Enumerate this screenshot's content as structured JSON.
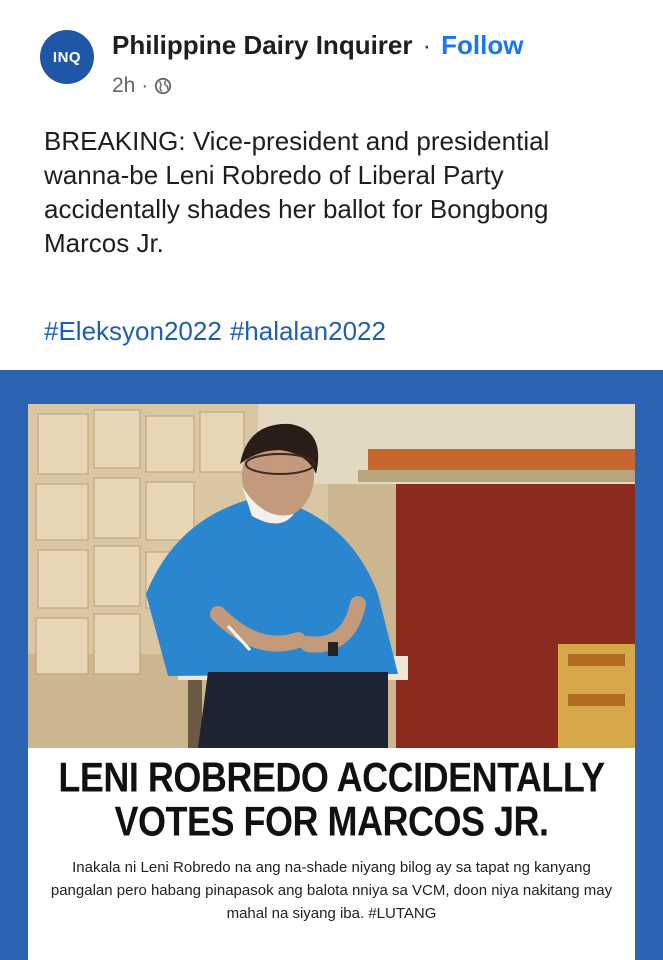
{
  "post": {
    "avatar_text": "INQ",
    "page_name": "Philippine Dairy Inquirer",
    "separator": "·",
    "follow_label": "Follow",
    "time": "2h ·",
    "privacy_icon": "globe-icon",
    "body": "BREAKING: Vice-president and presidential wanna-be Leni Robredo of Liberal Party accidentally shades her ballot for Bongbong Marcos Jr.",
    "hashtags": [
      "#Eleksyon2022",
      "#halalan2022"
    ]
  },
  "card": {
    "headline_line1": "LENI ROBREDO ACCIDENTALLY",
    "headline_line2": "VOTES FOR MARCOS JR.",
    "subtext": "Inakala ni Leni Robredo na ang na-shade niyang bilog ay sa tapat ng kanyang pangalan pero habang pinapasok ang balota nniya sa VCM, doon niya nakitang may mahal na siyang iba. #LUTANG",
    "frame_color": "#2b64b3"
  }
}
